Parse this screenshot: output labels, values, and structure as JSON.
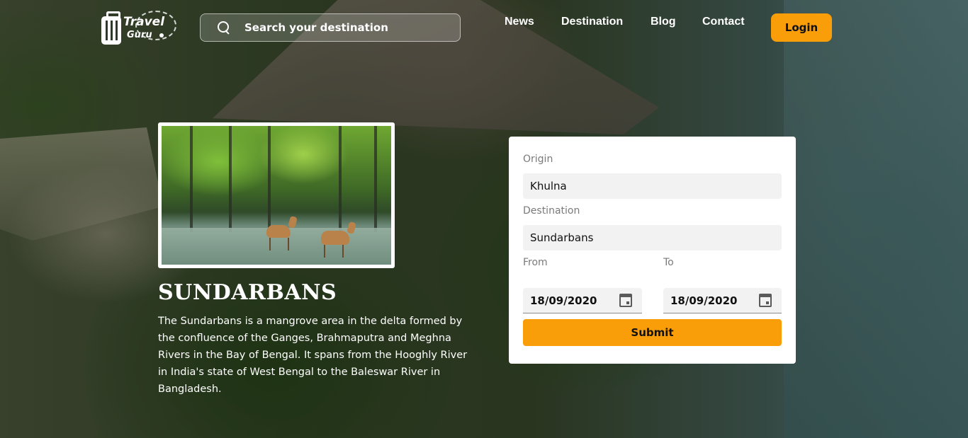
{
  "header": {
    "logo": {
      "line1": "Travel",
      "line2": "Guru"
    },
    "search": {
      "placeholder": "Search your destination"
    },
    "nav": [
      "News",
      "Destination",
      "Blog",
      "Contact"
    ],
    "login_label": "Login",
    "accent_color": "#f99d08"
  },
  "place": {
    "title": "SUNDARBANS",
    "description": "The Sundarbans is a mangrove area in the delta formed by the confluence of the Ganges, Brahmaputra and Meghna Rivers in the Bay of Bengal. It spans from the Hooghly River in India's state of West Bengal to the Baleswar River in Bangladesh."
  },
  "booking": {
    "origin_label": "Origin",
    "origin_value": "Khulna",
    "destination_label": "Destination",
    "destination_value": "Sundarbans",
    "from_label": "From",
    "from_value": "18/09/2020",
    "to_label": "To",
    "to_value": "18/09/2020",
    "submit_label": "Submit"
  }
}
